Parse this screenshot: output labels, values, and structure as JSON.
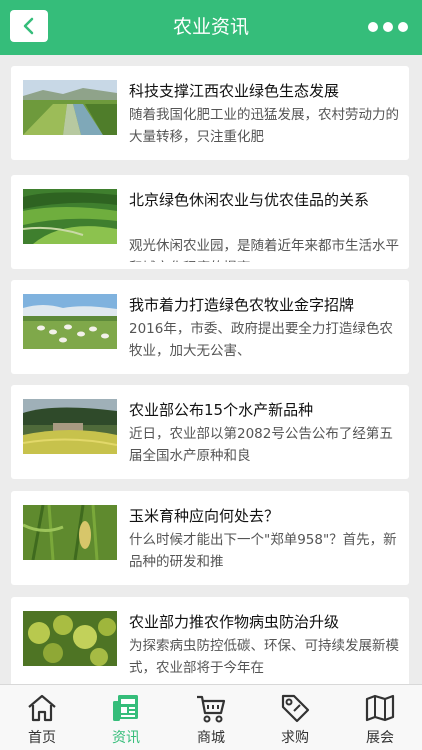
{
  "header": {
    "title": "农业资讯",
    "back_icon": "chevron-left-icon",
    "more_icon": "more-dots-icon"
  },
  "articles": [
    {
      "title": "科技支撑江西农业绿色生态发展",
      "summary": "随着我国化肥工业的迅猛发展，农村劳动力的大量转移，只注重化肥",
      "image": "farm-canal-image"
    },
    {
      "title": "北京绿色休闲农业与优农佳品的关系",
      "summary": "观光休闲农业园，是随着近年来都市生活水平和城市化程度的提高",
      "image": "green-fields-image"
    },
    {
      "title": "我市着力打造绿色农牧业金字招牌",
      "summary": "2016年，市委、政府提出要全力打造绿色农牧业，加大无公害、",
      "image": "sheep-pasture-image"
    },
    {
      "title": "农业部公布15个水产新品种",
      "summary": "近日，农业部以第2082号公告公布了经第五届全国水产原种和良",
      "image": "terrace-village-image"
    },
    {
      "title": "玉米育种应向何处去？",
      "summary": "什么时候才能出下一个\"郑单958\"？首先，新品种的研发和推",
      "image": "corn-field-image"
    },
    {
      "title": "农业部力推农作物病虫防治升级",
      "summary": "为探索病虫防控低碳、环保、可持续发展新模式，农业部将于今年在",
      "image": "crop-closeup-image"
    }
  ],
  "tabs": [
    {
      "label": "首页",
      "icon": "home-icon",
      "active": false
    },
    {
      "label": "资讯",
      "icon": "news-icon",
      "active": true
    },
    {
      "label": "商城",
      "icon": "cart-icon",
      "active": false
    },
    {
      "label": "求购",
      "icon": "tag-icon",
      "active": false
    },
    {
      "label": "展会",
      "icon": "map-icon",
      "active": false
    }
  ],
  "colors": {
    "brand": "#35bd7a",
    "background": "#ececec"
  }
}
